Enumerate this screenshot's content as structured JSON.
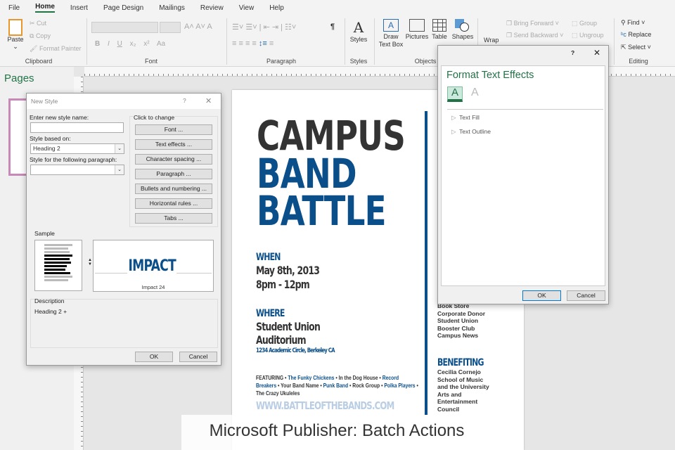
{
  "tabs": [
    "File",
    "Home",
    "Insert",
    "Page Design",
    "Mailings",
    "Review",
    "View",
    "Help"
  ],
  "active_tab": "Home",
  "ribbon": {
    "clipboard": {
      "paste": "Paste",
      "cut": "Cut",
      "copy": "Copy",
      "format_painter": "Format Painter",
      "label": "Clipboard"
    },
    "font": {
      "label": "Font",
      "bold": "B",
      "italic": "I",
      "underline": "U",
      "change_case": "Aa"
    },
    "paragraph": {
      "label": "Paragraph",
      "pilcrow": "¶"
    },
    "styles": {
      "button": "Styles",
      "label": "Styles"
    },
    "objects": {
      "draw_text_box": "Draw Text Box",
      "pictures": "Pictures",
      "table": "Table",
      "shapes": "Shapes",
      "label": "Objects"
    },
    "arrange": {
      "wrap": "Wrap",
      "bring_forward": "Bring Forward",
      "send_backward": "Send Backward",
      "group": "Group",
      "ungroup": "Ungroup"
    },
    "editing": {
      "find": "Find",
      "replace": "Replace",
      "select": "Select",
      "label": "Editing"
    }
  },
  "pages_pane": {
    "title": "Pages"
  },
  "flyer": {
    "title": [
      "CAMPUS",
      "BAND",
      "BATTLE"
    ],
    "when_head": "WHEN",
    "date": "May 8th, 2013",
    "time": "8pm - 12pm",
    "where_head": "WHERE",
    "venue1": "Student Union",
    "venue2": "Auditorium",
    "address": "1234 Academic Circle, Berkeley CA",
    "featuring": [
      {
        "t": "FEATURING • ",
        "c": "dark"
      },
      {
        "t": "The Funky Chickens",
        "c": "blue"
      },
      {
        "t": " • In the Dog House • ",
        "c": "dark"
      },
      {
        "t": "Record Breakers",
        "c": "blue"
      },
      {
        "t": " • Your Band Name • ",
        "c": "dark"
      },
      {
        "t": "Punk Band",
        "c": "blue"
      },
      {
        "t": " • Rock Group • ",
        "c": "dark"
      },
      {
        "t": "Polka Players",
        "c": "blue"
      },
      {
        "t": " • The Crazy Ukuleles",
        "c": "dark"
      }
    ],
    "website": "WWW.BATTLEOFTHEBANDS.COM",
    "sponsors": [
      "Book Store",
      "Corporate Donor",
      "Student Union",
      "Booster Club",
      "Campus News"
    ],
    "benefiting_head": "BENEFITING",
    "benefiting": "Cecilia Cornejo School of Music and the University Arts and Entertainment Council",
    "colors": {
      "dark": "#333333",
      "blue": "#0b4f8a"
    }
  },
  "new_style": {
    "title": "New Style",
    "help": "?",
    "close": "✕",
    "name_label": "Enter new style name:",
    "name_value": "",
    "based_label": "Style based on:",
    "based_value": "Heading 2",
    "following_label": "Style for the following paragraph:",
    "following_value": "",
    "click_label": "Click to change",
    "buttons": [
      "Font ...",
      "Text effects ...",
      "Character spacing ...",
      "Paragraph ...",
      "Bullets and numbering ...",
      "Horizontal rules ...",
      "Tabs ..."
    ],
    "sample_label": "Sample",
    "sample_text": "IMPACT",
    "sample_font": "Impact 24",
    "description_label": "Description",
    "description": "Heading 2 +",
    "ok": "OK",
    "cancel": "Cancel"
  },
  "text_effects": {
    "help": "?",
    "close": "✕",
    "title": "Format Text Effects",
    "sections": [
      "Text Fill",
      "Text Outline"
    ],
    "ok": "OK",
    "cancel": "Cancel",
    "accent": "#217346"
  },
  "caption": "Microsoft Publisher: Batch Actions"
}
